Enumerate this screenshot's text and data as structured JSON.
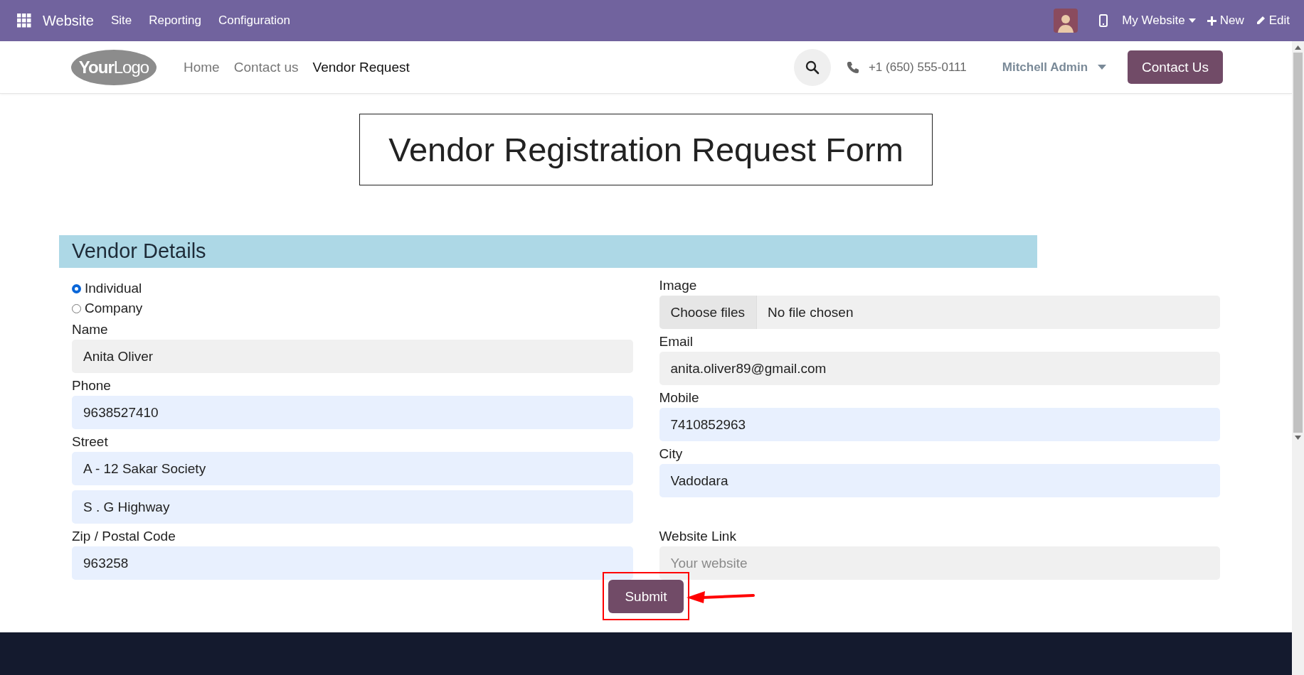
{
  "top_bar": {
    "app": "Website",
    "menu": [
      "Site",
      "Reporting",
      "Configuration"
    ],
    "site_switcher": "My Website",
    "new": "New",
    "edit": "Edit"
  },
  "header": {
    "logo": {
      "part_1": "Your",
      "part_2": "Logo"
    },
    "nav": [
      {
        "label": "Home",
        "selected": false
      },
      {
        "label": "Contact us",
        "selected": false
      },
      {
        "label": "Vendor Request",
        "selected": true
      }
    ],
    "phone": "+1 (650) 555-0111",
    "user": "Mitchell Admin",
    "cta": "Contact Us"
  },
  "form": {
    "title": "Vendor Registration Request Form",
    "section": "Vendor Details",
    "type_options": [
      {
        "label": "Individual",
        "selected": true
      },
      {
        "label": "Company",
        "selected": false
      }
    ],
    "left_fields": [
      {
        "kind": "text",
        "label": "Name",
        "value": "Anita Oliver",
        "autofilled": false
      },
      {
        "kind": "text",
        "label": "Phone",
        "value": "9638527410",
        "autofilled": true
      },
      {
        "kind": "text",
        "label": "Street",
        "value": "A - 12 Sakar Society",
        "autofilled": true
      },
      {
        "kind": "text",
        "value": "S . G Highway",
        "autofilled": true
      },
      {
        "kind": "text",
        "label": "Zip / Postal Code",
        "value": "963258",
        "autofilled": true
      }
    ],
    "right_fields": [
      {
        "kind": "file",
        "label": "Image",
        "button": "Choose files",
        "value": "No file chosen"
      },
      {
        "kind": "text",
        "label": "Email",
        "value": "anita.oliver89@gmail.com",
        "autofilled": false
      },
      {
        "kind": "text",
        "label": "Mobile",
        "value": "7410852963",
        "autofilled": true
      },
      {
        "kind": "text",
        "label": "City",
        "value": "Vadodara",
        "autofilled": true
      },
      {
        "kind": "text",
        "label": "Website Link",
        "placeholder": "Your website",
        "autofilled": false
      }
    ],
    "submit": {
      "label": "Submit",
      "highlighted": true
    }
  }
}
